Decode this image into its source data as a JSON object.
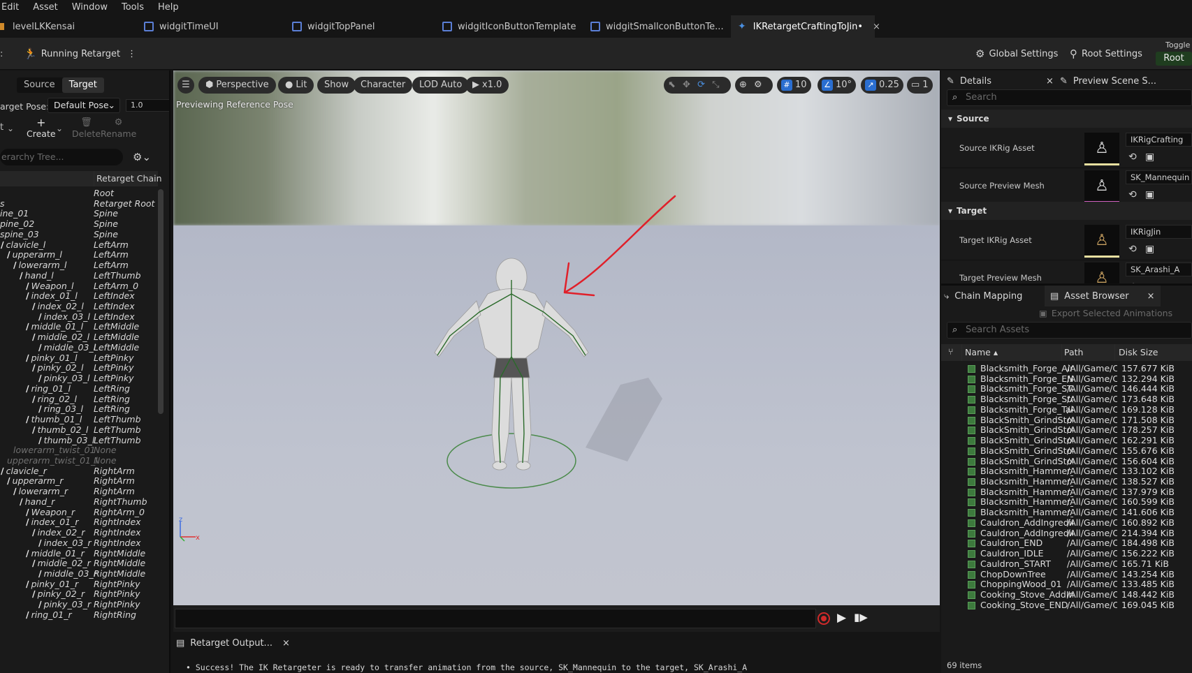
{
  "menu": [
    "Edit",
    "Asset",
    "Window",
    "Tools",
    "Help"
  ],
  "tabs": [
    {
      "label": "levelLKKensai"
    },
    {
      "label": "widgitTimeUI"
    },
    {
      "label": "widgitTopPanel"
    },
    {
      "label": "widgitIconButtonTemplate"
    },
    {
      "label": "widgitSmallconButtonTe..."
    },
    {
      "label": "IKRetargetCraftingToJin•",
      "close": "×"
    }
  ],
  "toolbar": {
    "running_retarget": "Running Retarget",
    "more": "⋮",
    "global_settings": "Global Settings",
    "root_settings": "Root Settings",
    "toggle_label": "Toggle",
    "toggle_value": "Root"
  },
  "left": {
    "source_tab": "Source",
    "target_tab": "Target",
    "target_pose_label": "arget Pose:",
    "target_pose_value": "Default Pose",
    "pose_amount": "1.0",
    "create": "Create",
    "delete": "Delete",
    "rename": "Rename",
    "t_label": "t",
    "search_placeholder": "erarchy Tree...",
    "col_retarget_chain": "Retarget Chain",
    "rows": [
      {
        "bone": "",
        "chain": "Root",
        "indent": 0,
        "dim": false
      },
      {
        "bone": "s",
        "chain": "Retarget Root",
        "indent": 0,
        "dim": false
      },
      {
        "bone": "ine_01",
        "chain": "Spine",
        "indent": 0,
        "dim": false
      },
      {
        "bone": "pine_02",
        "chain": "Spine",
        "indent": 0,
        "dim": false
      },
      {
        "bone": "spine_03",
        "chain": "Spine",
        "indent": 0,
        "dim": false
      },
      {
        "bone": "clavicle_l",
        "chain": "LeftArm",
        "indent": 1,
        "dim": false
      },
      {
        "bone": "upperarm_l",
        "chain": "LeftArm",
        "indent": 2,
        "dim": false
      },
      {
        "bone": "lowerarm_l",
        "chain": "LeftArm",
        "indent": 3,
        "dim": false
      },
      {
        "bone": "hand_l",
        "chain": "LeftThumb",
        "indent": 4,
        "dim": false
      },
      {
        "bone": "Weapon_l",
        "chain": "LeftArm_0",
        "indent": 5,
        "dim": false
      },
      {
        "bone": "index_01_l",
        "chain": "LeftIndex",
        "indent": 5,
        "dim": false
      },
      {
        "bone": "index_02_l",
        "chain": "LeftIndex",
        "indent": 6,
        "dim": false
      },
      {
        "bone": "index_03_l",
        "chain": "LeftIndex",
        "indent": 7,
        "dim": false
      },
      {
        "bone": "middle_01_l",
        "chain": "LeftMiddle",
        "indent": 5,
        "dim": false
      },
      {
        "bone": "middle_02_l",
        "chain": "LeftMiddle",
        "indent": 6,
        "dim": false
      },
      {
        "bone": "middle_03_l",
        "chain": "LeftMiddle",
        "indent": 7,
        "dim": false
      },
      {
        "bone": "pinky_01_l",
        "chain": "LeftPinky",
        "indent": 5,
        "dim": false
      },
      {
        "bone": "pinky_02_l",
        "chain": "LeftPinky",
        "indent": 6,
        "dim": false
      },
      {
        "bone": "pinky_03_l",
        "chain": "LeftPinky",
        "indent": 7,
        "dim": false
      },
      {
        "bone": "ring_01_l",
        "chain": "LeftRing",
        "indent": 5,
        "dim": false
      },
      {
        "bone": "ring_02_l",
        "chain": "LeftRing",
        "indent": 6,
        "dim": false
      },
      {
        "bone": "ring_03_l",
        "chain": "LeftRing",
        "indent": 7,
        "dim": false
      },
      {
        "bone": "thumb_01_l",
        "chain": "LeftThumb",
        "indent": 5,
        "dim": false
      },
      {
        "bone": "thumb_02_l",
        "chain": "LeftThumb",
        "indent": 6,
        "dim": false
      },
      {
        "bone": "thumb_03_l",
        "chain": "LeftThumb",
        "indent": 7,
        "dim": false
      },
      {
        "bone": "lowerarm_twist_01",
        "chain": "None",
        "indent": 3,
        "dim": true
      },
      {
        "bone": "upperarm_twist_01_l",
        "chain": "None",
        "indent": 2,
        "dim": true
      },
      {
        "bone": "clavicle_r",
        "chain": "RightArm",
        "indent": 1,
        "dim": false
      },
      {
        "bone": "upperarm_r",
        "chain": "RightArm",
        "indent": 2,
        "dim": false
      },
      {
        "bone": "lowerarm_r",
        "chain": "RightArm",
        "indent": 3,
        "dim": false
      },
      {
        "bone": "hand_r",
        "chain": "RightThumb",
        "indent": 4,
        "dim": false
      },
      {
        "bone": "Weapon_r",
        "chain": "RightArm_0",
        "indent": 5,
        "dim": false
      },
      {
        "bone": "index_01_r",
        "chain": "RightIndex",
        "indent": 5,
        "dim": false
      },
      {
        "bone": "index_02_r",
        "chain": "RightIndex",
        "indent": 6,
        "dim": false
      },
      {
        "bone": "index_03_r",
        "chain": "RightIndex",
        "indent": 7,
        "dim": false
      },
      {
        "bone": "middle_01_r",
        "chain": "RightMiddle",
        "indent": 5,
        "dim": false
      },
      {
        "bone": "middle_02_r",
        "chain": "RightMiddle",
        "indent": 6,
        "dim": false
      },
      {
        "bone": "middle_03_r",
        "chain": "RightMiddle",
        "indent": 7,
        "dim": false
      },
      {
        "bone": "pinky_01_r",
        "chain": "RightPinky",
        "indent": 5,
        "dim": false
      },
      {
        "bone": "pinky_02_r",
        "chain": "RightPinky",
        "indent": 6,
        "dim": false
      },
      {
        "bone": "pinky_03_r",
        "chain": "RightPinky",
        "indent": 7,
        "dim": false
      },
      {
        "bone": "ring_01_r",
        "chain": "RightRing",
        "indent": 5,
        "dim": false
      }
    ]
  },
  "viewport": {
    "perspective": "Perspective",
    "lit": "Lit",
    "show": "Show",
    "character": "Character",
    "lod": "LOD Auto",
    "speed": "x1.0",
    "grid": "10",
    "angle": "10°",
    "scale": "0.25",
    "camera": "1",
    "caption": "Previewing Reference Pose"
  },
  "output": {
    "tab": "Retarget Output...",
    "close": "×",
    "message": "Success! The IK Retargeter is ready to transfer animation from the source, SK_Mannequin to the target, SK_Arashi_A"
  },
  "details": {
    "tab": "Details",
    "close": "×",
    "preview_tab": "Preview Scene S...",
    "search_placeholder": "Search",
    "source_section": "Source",
    "target_section": "Target",
    "props": [
      {
        "label": "Source IKRig Asset",
        "value": "IKRigCrafting"
      },
      {
        "label": "Source Preview Mesh",
        "value": "SK_Mannequin"
      },
      {
        "label": "Target IKRig Asset",
        "value": "IKRigJin"
      },
      {
        "label": "Target Preview Mesh",
        "value": "SK_Arashi_A"
      }
    ]
  },
  "asset_browser": {
    "chain_mapping_tab": "Chain Mapping",
    "tab": "Asset Browser",
    "close": "×",
    "export_label": "Export Selected Animations",
    "search_placeholder": "Search Assets",
    "col_name": "Name",
    "col_path": "Path",
    "col_size": "Disk Size",
    "rows": [
      {
        "name": "Blacksmith_Forge_Airfl",
        "path": "/All/Game/Cr",
        "size": "157.677 KiB"
      },
      {
        "name": "Blacksmith_Forge_END",
        "path": "/All/Game/Cr",
        "size": "132.294 KiB"
      },
      {
        "name": "Blacksmith_Forge_STA",
        "path": "/All/Game/Cr",
        "size": "146.444 KiB"
      },
      {
        "name": "Blacksmith_Forge_Stok",
        "path": "/All/Game/Cr",
        "size": "173.648 KiB"
      },
      {
        "name": "Blacksmith_Forge_Tak",
        "path": "/All/Game/Cr",
        "size": "169.128 KiB"
      },
      {
        "name": "BlackSmith_GrindStone",
        "path": "/All/Game/Cr",
        "size": "171.508 KiB"
      },
      {
        "name": "BlackSmith_GrindStone",
        "path": "/All/Game/Cr",
        "size": "178.257 KiB"
      },
      {
        "name": "BlackSmith_GrindStone",
        "path": "/All/Game/Cr",
        "size": "162.291 KiB"
      },
      {
        "name": "BlackSmith_GrindStone",
        "path": "/All/Game/Cr",
        "size": "155.676 KiB"
      },
      {
        "name": "BlackSmith_GrindStone",
        "path": "/All/Game/Cr",
        "size": "156.604 KiB"
      },
      {
        "name": "Blacksmith_Hammer_E",
        "path": "/All/Game/Cr",
        "size": "133.102 KiB"
      },
      {
        "name": "Blacksmith_Hammer_II",
        "path": "/All/Game/Cr",
        "size": "138.527 KiB"
      },
      {
        "name": "Blacksmith_Hammer_II",
        "path": "/All/Game/Cr",
        "size": "137.979 KiB"
      },
      {
        "name": "Blacksmith_Hammer_S",
        "path": "/All/Game/Cr",
        "size": "160.599 KiB"
      },
      {
        "name": "Blacksmith_Hammer_S",
        "path": "/All/Game/Cr",
        "size": "141.606 KiB"
      },
      {
        "name": "Cauldron_AddIngredien",
        "path": "/All/Game/Cr",
        "size": "160.892 KiB"
      },
      {
        "name": "Cauldron_AddIngredien",
        "path": "/All/Game/Cr",
        "size": "214.394 KiB"
      },
      {
        "name": "Cauldron_END",
        "path": "/All/Game/Cr",
        "size": "184.498 KiB"
      },
      {
        "name": "Cauldron_IDLE",
        "path": "/All/Game/Cr",
        "size": "156.222 KiB"
      },
      {
        "name": "Cauldron_START",
        "path": "/All/Game/Cr",
        "size": "165.71 KiB"
      },
      {
        "name": "ChopDownTree",
        "path": "/All/Game/Cr",
        "size": "143.254 KiB"
      },
      {
        "name": "ChoppingWood_01",
        "path": "/All/Game/Cr",
        "size": "133.485 KiB"
      },
      {
        "name": "Cooking_Stove_AddIng",
        "path": "/All/Game/Cr",
        "size": "148.442 KiB"
      },
      {
        "name": "Cooking_Stove_END",
        "path": "/All/Game/Cr",
        "size": "169.045 KiB"
      }
    ],
    "item_count": "69 items"
  }
}
